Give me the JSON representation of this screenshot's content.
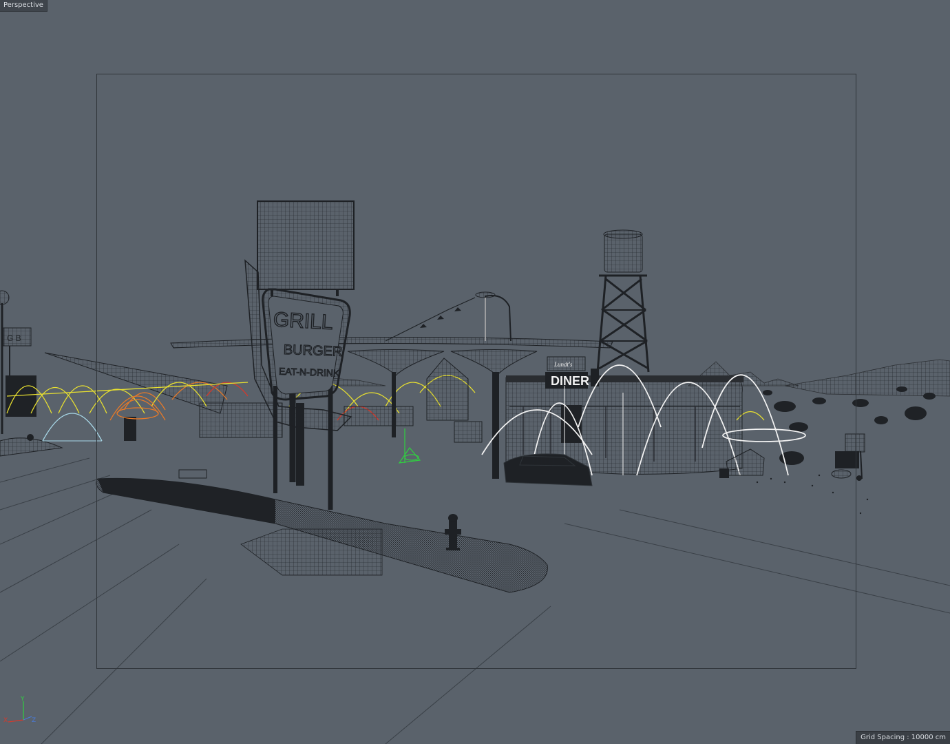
{
  "viewport": {
    "label": "Perspective",
    "grid_spacing_text": "Grid Spacing : 10000 cm",
    "background_color": "#5a626b"
  },
  "scene": {
    "sign_lines": [
      "GRILL",
      "BURGER",
      "EAT-N-DRINK"
    ],
    "diner_sign": "DINER",
    "diner_script": "Lundt's",
    "left_sign": "G B"
  },
  "axis_gizmo": {
    "x": "X",
    "y": "Y",
    "z": "Z"
  },
  "colors": {
    "wire_dark": "#2a2d31",
    "light_yellow": "#e8e030",
    "light_orange": "#e87a28",
    "light_red": "#d8382a",
    "light_white": "#f2f2f2",
    "light_cyan": "#a8d8e8",
    "axis_green": "#30d040"
  }
}
